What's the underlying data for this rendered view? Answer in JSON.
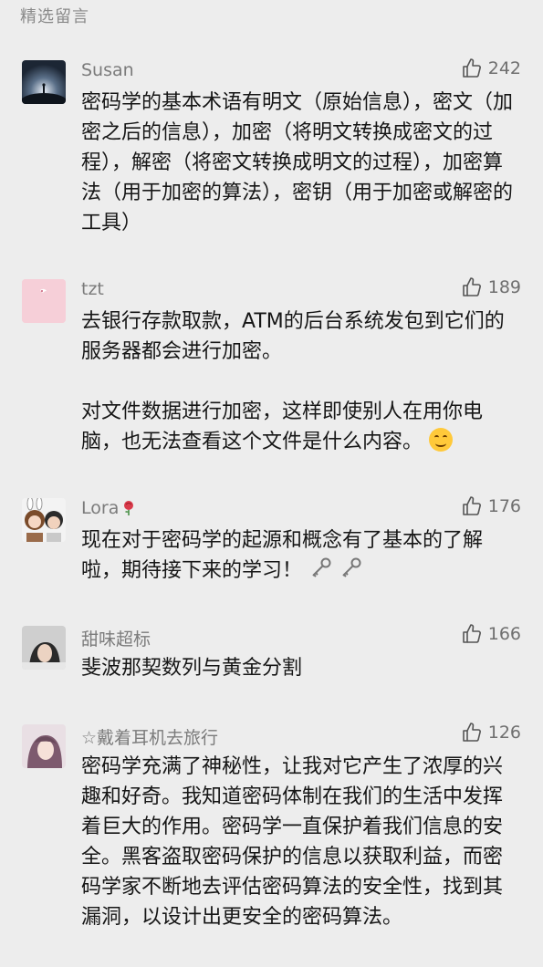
{
  "section": {
    "title": "精选留言"
  },
  "comments": [
    {
      "name": "Susan",
      "likes": "242",
      "paragraphs": [
        "密码学的基本术语有明文（原始信息），密文（加密之后的信息），加密（将明文转换成密文的过程），解密（将密文转换成明文的过程），加密算法（用于加密的算法），密钥（用于加密或解密的工具）"
      ]
    },
    {
      "name": "tzt",
      "likes": "189",
      "paragraphs": [
        "去银行存款取款，ATM的后台系统发包到它们的服务器都会进行加密。",
        "对文件数据进行加密，这样即使别人在用你电脑，也无法查看这个文件是什么内容。"
      ]
    },
    {
      "name": "Lora",
      "likes": "176",
      "paragraphs": [
        "现在对于密码学的起源和概念有了基本的了解啦，期待接下来的学习！"
      ]
    },
    {
      "name": "甜味超标",
      "likes": "166",
      "paragraphs": [
        "斐波那契数列与黄金分割"
      ]
    },
    {
      "name": "☆戴着耳机去旅行",
      "likes": "126",
      "paragraphs": [
        "密码学充满了神秘性，让我对它产生了浓厚的兴趣和好奇。我知道密码体制在我们的生活中发挥着巨大的作用。密码学一直保护着我们信息的安全。黑客盗取密码保护的信息以获取利益，而密码学家不断地去评估密码算法的安全性，找到其漏洞，以设计出更安全的密码算法。"
      ]
    }
  ],
  "colors": {
    "background": "#ededed",
    "name": "#7b7b7b",
    "text": "#161616"
  },
  "icons": [
    "thumbs-up-icon",
    "smile-emoji-icon",
    "key-icon",
    "rose-icon"
  ]
}
